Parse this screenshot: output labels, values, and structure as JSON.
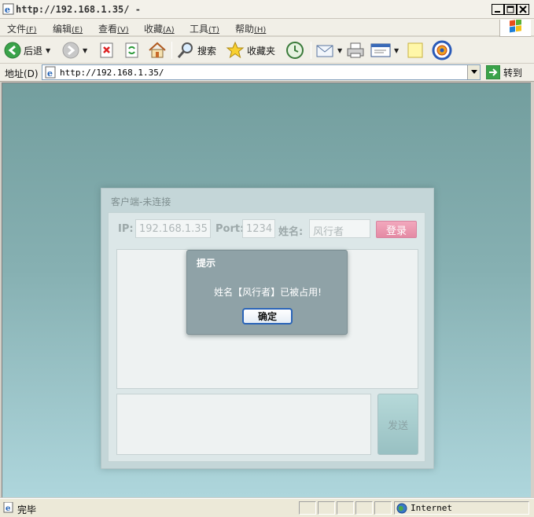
{
  "window": {
    "title": "http://192.168.1.35/ -",
    "minimize": "_",
    "maximize": "□",
    "close": "×"
  },
  "menu": [
    {
      "label": "文件",
      "key": "(F)"
    },
    {
      "label": "编辑",
      "key": "(E)"
    },
    {
      "label": "查看",
      "key": "(V)"
    },
    {
      "label": "收藏",
      "key": "(A)"
    },
    {
      "label": "工具",
      "key": "(T)"
    },
    {
      "label": "帮助",
      "key": "(H)"
    }
  ],
  "toolbar": {
    "back": "后退",
    "search": "搜索",
    "favorites": "收藏夹"
  },
  "address": {
    "label": "地址(D)",
    "url": "http://192.168.1.35/",
    "go": "转到"
  },
  "client": {
    "title": "客户端-未连接",
    "ip_label": "IP:",
    "ip_value": "192.168.1.35",
    "port_label": "Port:",
    "port_value": "1234",
    "name_label": "姓名:",
    "name_value": "风行者",
    "login": "登录",
    "send": "发送"
  },
  "dialog": {
    "title": "提示",
    "message": "姓名【风行者】已被占用!",
    "ok": "确定"
  },
  "status": {
    "text": "完毕",
    "zone": "Internet"
  },
  "colors": {
    "accent_blue": "#2a64b8",
    "login_pink": "#e48aa4",
    "content_teal": "#739e9e"
  }
}
